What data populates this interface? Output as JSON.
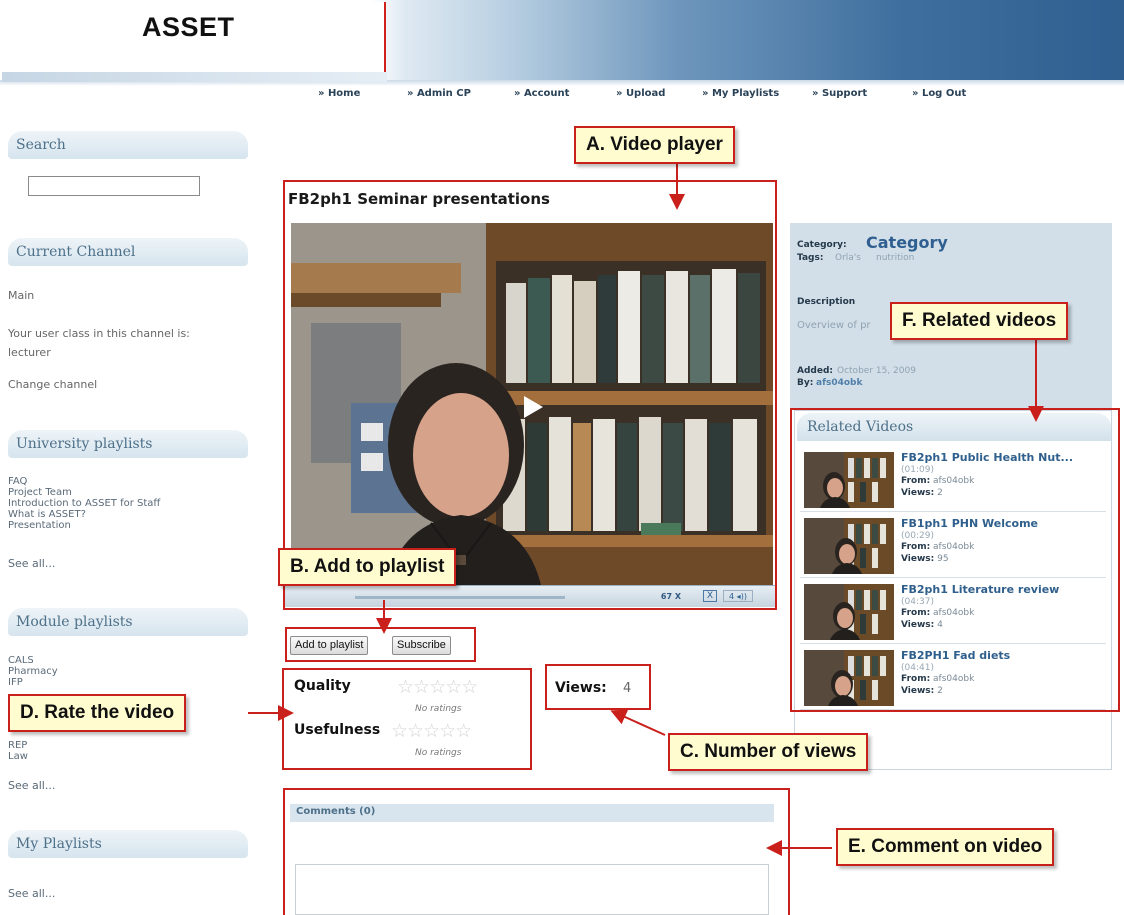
{
  "header": {
    "logo": "ASSET"
  },
  "nav": {
    "items": [
      {
        "label": "» Home"
      },
      {
        "label": "» Admin CP"
      },
      {
        "label": "» Account"
      },
      {
        "label": "» Upload"
      },
      {
        "label": "» My Playlists"
      },
      {
        "label": "» Support"
      },
      {
        "label": "» Log Out"
      }
    ]
  },
  "sidebar": {
    "search": {
      "title": "Search",
      "value": ""
    },
    "current_channel": {
      "title": "Current Channel",
      "channel": "Main",
      "user_class_text": "Your user class in this channel is:",
      "user_class": "lecturer",
      "change_link": "Change channel"
    },
    "university_playlists": {
      "title": "University playlists",
      "items": [
        "FAQ",
        "Project Team",
        "Introduction to ASSET for Staff",
        "What is ASSET?",
        "Presentation"
      ],
      "see_all": "See all..."
    },
    "module_playlists": {
      "title": "Module playlists",
      "items": [
        "CALS",
        "Pharmacy",
        "IFP",
        "REP",
        "Law"
      ],
      "see_all": "See all..."
    },
    "my_playlists": {
      "title": "My Playlists",
      "see_all": "See all..."
    }
  },
  "video": {
    "title": "FB2ph1 Seminar presentations",
    "time": "67 X",
    "full_icon": "X",
    "volume": "4 ◂))",
    "add_to_playlist": "Add to playlist",
    "subscribe": "Subscribe"
  },
  "ratings": {
    "quality_label": "Quality",
    "usefulness_label": "Usefulness",
    "no_ratings": "No ratings",
    "stars": "☆☆☆☆☆"
  },
  "views": {
    "label": "Views:",
    "value": "4"
  },
  "info": {
    "category_label": "Category:",
    "category_value": "Category",
    "tags_label": "Tags:",
    "tags": [
      "Orla's",
      "nutrition"
    ],
    "description_label": "Description",
    "description": "Overview of pr",
    "added_label": "Added:",
    "added": "October 15, 2009",
    "by_label": "By:",
    "by": "afs04obk"
  },
  "related": {
    "title": "Related Videos",
    "from_label": "From:",
    "views_label": "Views:",
    "items": [
      {
        "title": "FB2ph1 Public Health Nut...",
        "duration": "(01:09)",
        "from": "afs04obk",
        "views": "2"
      },
      {
        "title": "FB1ph1 PHN Welcome",
        "duration": "(00:29)",
        "from": "afs04obk",
        "views": "95"
      },
      {
        "title": "FB2ph1 Literature review",
        "duration": "(04:37)",
        "from": "afs04obk",
        "views": "4"
      },
      {
        "title": "FB2PH1 Fad diets",
        "duration": "(04:41)",
        "from": "afs04obk",
        "views": "2"
      }
    ]
  },
  "comments": {
    "title": "Comments (0)"
  },
  "callouts": {
    "a": "A. Video player",
    "b": "B. Add to playlist",
    "c": "C. Number of views",
    "d": "D. Rate the video",
    "e": "E. Comment on video",
    "f": "F. Related videos"
  },
  "colors": {
    "callout_border": "#c9201c",
    "callout_fill": "#fffccf",
    "link_blue": "#2f5f8c",
    "panel_blue": "#d3dfe8"
  }
}
